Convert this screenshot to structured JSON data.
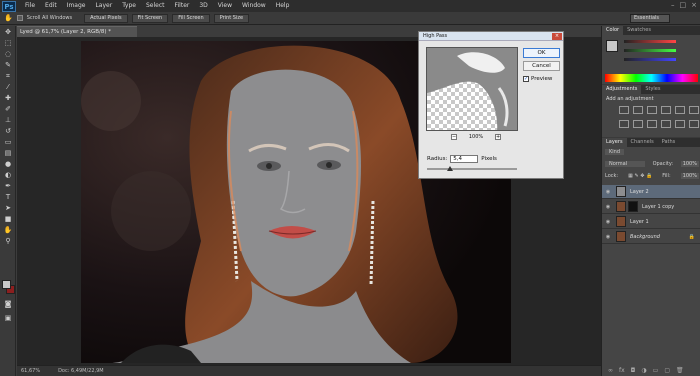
{
  "app": {
    "logo": "Ps"
  },
  "menu": [
    "File",
    "Edit",
    "Image",
    "Layer",
    "Type",
    "Select",
    "Filter",
    "3D",
    "View",
    "Window",
    "Help"
  ],
  "window_controls": [
    "–",
    "□",
    "×"
  ],
  "options": {
    "scroll_all": "Scroll All Windows",
    "actual_pixels": "Actual Pixels",
    "fit_screen": "Fit Screen",
    "fill_screen": "Fill Screen",
    "print_size": "Print Size",
    "workspace": "Essentials"
  },
  "document": {
    "tab_title": "Lyed @ 61,7% (Layer 2, RGB/8) *"
  },
  "status": {
    "zoom": "61,67%",
    "doc": "Doc: 6,49M/22,9M"
  },
  "dialog": {
    "title": "High Pass",
    "ok": "OK",
    "cancel": "Cancel",
    "preview": "Preview",
    "zoom": "100%",
    "zoom_out": "−",
    "zoom_in": "+",
    "radius_label": "Radius:",
    "radius_value": "5,4",
    "radius_unit": "Pixels",
    "slider_fraction": 0.25
  },
  "color_panel": {
    "tabs": [
      "Color",
      "Swatches"
    ]
  },
  "adjustments": {
    "tabs": [
      "Adjustments",
      "Styles"
    ],
    "heading": "Add an adjustment"
  },
  "layers": {
    "tabs": [
      "Layers",
      "Channels",
      "Paths"
    ],
    "kind": "Kind",
    "blend_mode": "Normal",
    "opacity_label": "Opacity:",
    "opacity": "100%",
    "lock_label": "Lock:",
    "fill_label": "Fill:",
    "fill": "100%",
    "items": [
      {
        "name": "Layer 2",
        "selected": true
      },
      {
        "name": "Layer 1 copy",
        "selected": false
      },
      {
        "name": "Layer 1",
        "selected": false
      },
      {
        "name": "Background",
        "selected": false
      }
    ]
  },
  "colors": {
    "bg_color": "#8c1f1f",
    "fg_color": "#c8c8c8",
    "accent": "#3b7bd4"
  }
}
